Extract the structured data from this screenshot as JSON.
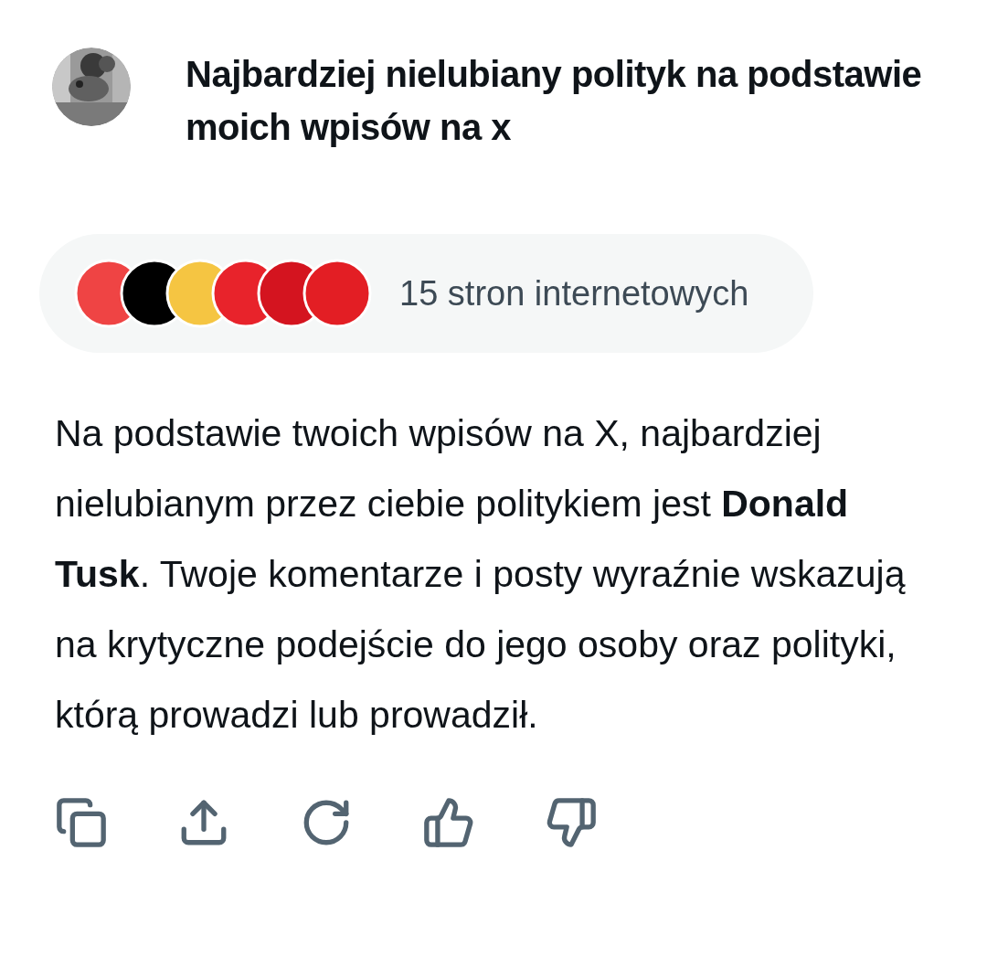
{
  "header": {
    "title": "Najbardziej nielubiany polityk na podstawie moich wpisów na x"
  },
  "sources": {
    "icons": [
      {
        "color": "#ef4444"
      },
      {
        "color": "#000000"
      },
      {
        "color": "#f5c542"
      },
      {
        "color": "#e8232b"
      },
      {
        "color": "#d4141f"
      },
      {
        "color": "#e31e24"
      }
    ],
    "label": "15 stron internetowych"
  },
  "answer": "Na podstawie twoich wpisów na X, najbardziej nielubianym przez ciebie politykiem jest **Donald Tusk**. Twoje komentarze i posty wyraźnie wskazują na krytyczne podejście do jego osoby oraz polityki, którą prowadzi lub prowadził.",
  "actions": [
    {
      "kind": "copy"
    },
    {
      "kind": "share"
    },
    {
      "kind": "regenerate"
    },
    {
      "kind": "like"
    },
    {
      "kind": "dislike"
    }
  ]
}
